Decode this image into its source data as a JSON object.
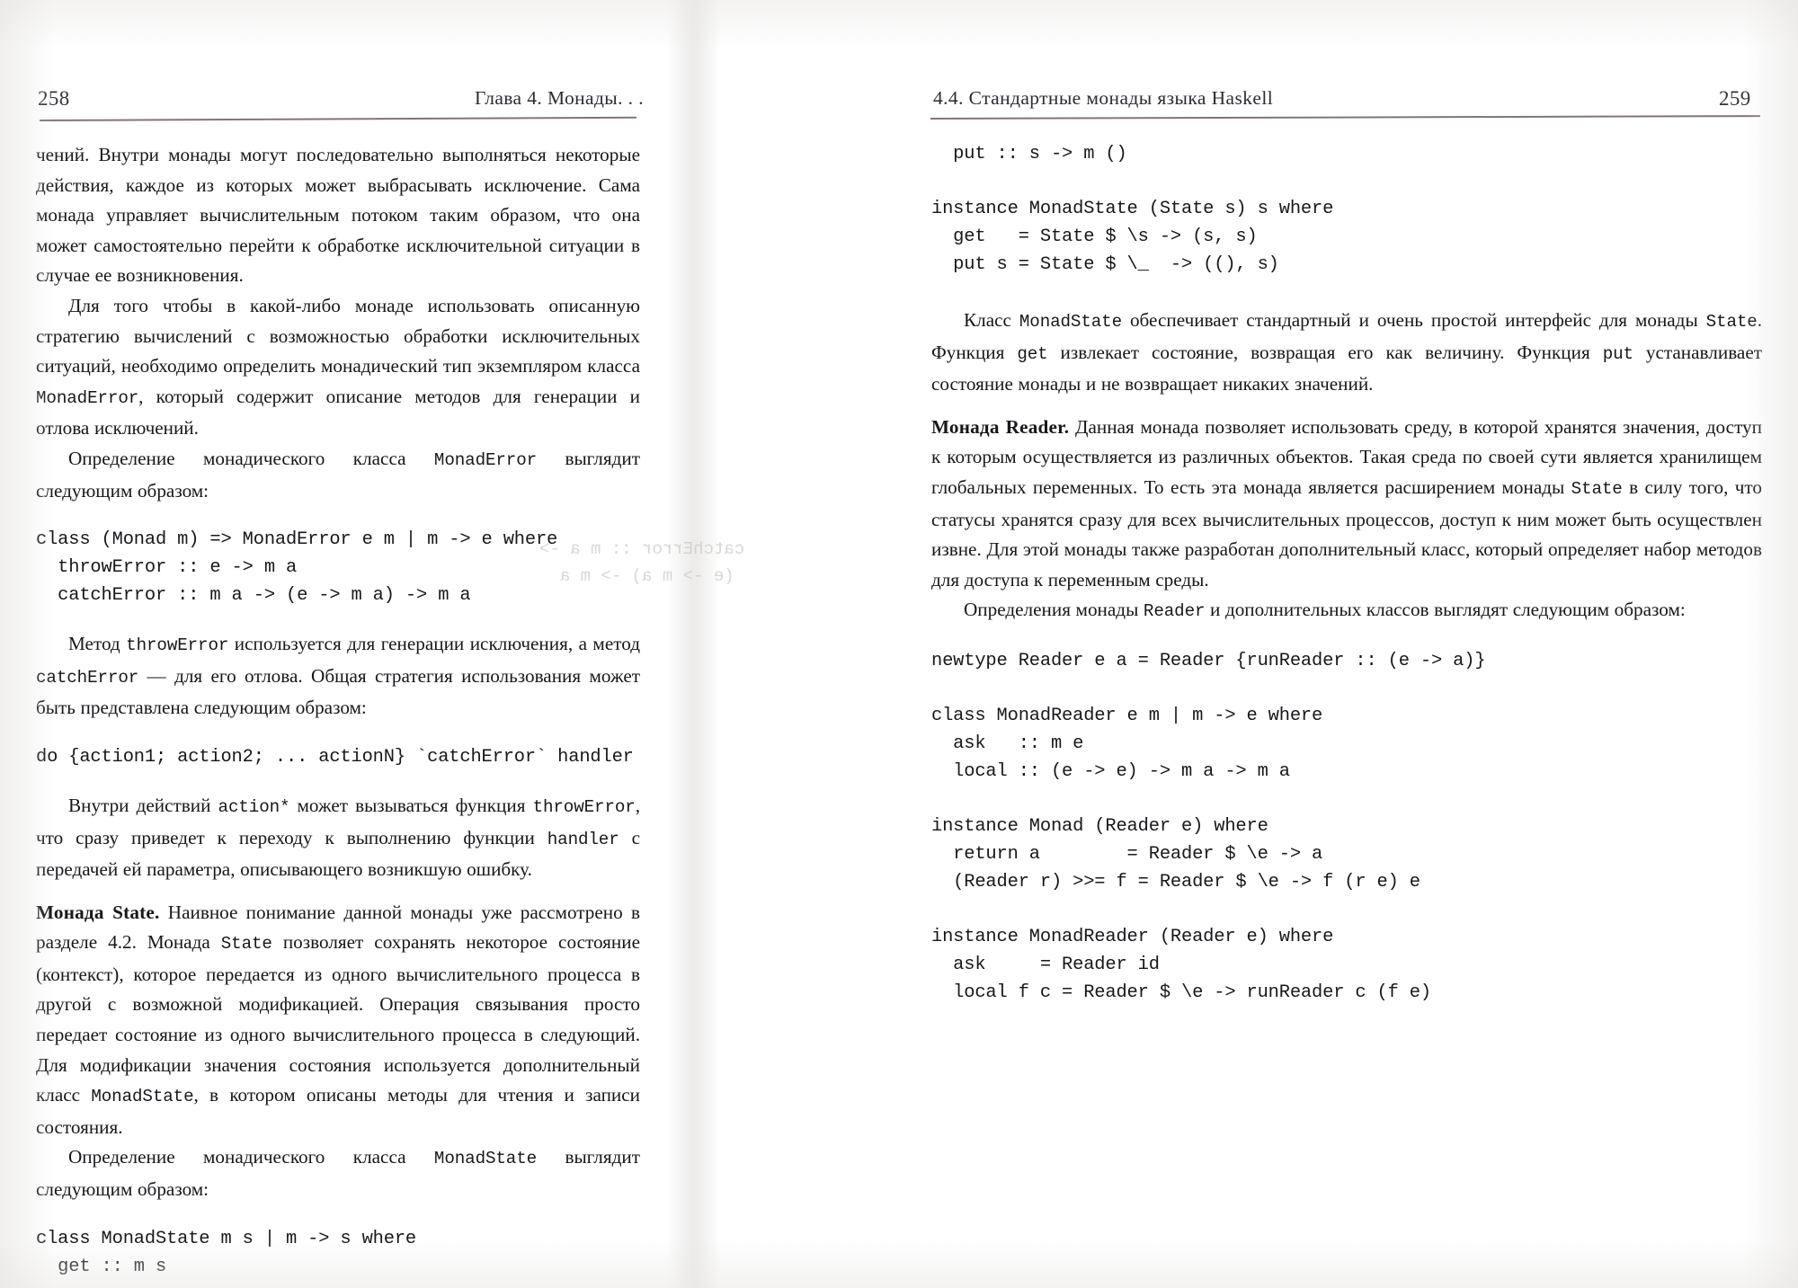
{
  "spread": {
    "left_page": {
      "folio": "258",
      "running_head": "Глава 4.  Монады. . ."
    },
    "right_page": {
      "folio": "259",
      "running_head": "4.4.  Стандартные монады языка Haskell"
    }
  },
  "left_column": {
    "p1": "чений. Внутри монады могут последовательно выполняться некоторые действия, каждое из которых может выбрасывать исключение. Сама монада управляет вычислительным потоком таким образом, что она может самостоятельно перейти к обработке исключительной ситуации в случае ее возникновения.",
    "p2_a": "Для того чтобы в какой-либо монаде использовать описанную стратегию вычислений с возможностью обработки исключительных ситуаций, необходимо определить монадический тип экземпляром класса ",
    "p2_code": "MonadError",
    "p2_b": ", который содержит описание методов для генерации и отлова исключений.",
    "p3_a": "Определение монадического класса ",
    "p3_code": "MonadError",
    "p3_b": " выглядит следующим образом:",
    "code1": "class (Monad m) => MonadError e m | m -> e where\n  throwError :: e -> m a\n  catchError :: m a -> (e -> m a) -> m a",
    "p4_a": "Метод ",
    "p4_code1": "throwError",
    "p4_b": " используется для генерации исключения, а метод ",
    "p4_code2": "catchError",
    "p4_c": " — для его отлова. Общая стратегия использования может быть представлена следующим образом:",
    "code2": "do {action1; action2; ... actionN} `catchError` handler",
    "p5_a": "Внутри действий ",
    "p5_code1": "action*",
    "p5_b": " может вызываться функция ",
    "p5_code2": "throwError",
    "p5_c": ", что сразу приведет к переходу к выполнению функции ",
    "p5_code3": "handler",
    "p5_d": " с передачей ей параметра, описывающего возникшую ошибку.",
    "p6_lead": "Монада State.",
    "p6_a": " Наивное понимание данной монады уже рассмотрено в разделе 4.2. Монада ",
    "p6_code1": "State",
    "p6_b": " позволяет сохранять некоторое состояние (контекст), которое передается из одного вычислительного процесса в другой с возможной модификацией. Операция связывания просто передает состояние из одного вычислительного процесса в следующий. Для модификации значения состояния используется дополнительный класс ",
    "p6_code2": "MonadState",
    "p6_c": ", в котором описаны методы для чтения и записи состояния.",
    "p7_a": "Определение монадического класса ",
    "p7_code": "MonadState",
    "p7_b": " выглядит следующим образом:",
    "code3": "class MonadState m s | m -> s where\n  get :: m s"
  },
  "right_column": {
    "code4": "  put :: s -> m ()",
    "code5": "instance MonadState (State s) s where\n  get   = State $ \\s -> (s, s)\n  put s = State $ \\_  -> ((), s)",
    "p1_a": "Класс ",
    "p1_code1": "MonadState",
    "p1_b": " обеспечивает стандартный и очень простой интерфейс для монады ",
    "p1_code2": "State",
    "p1_c": ". Функция ",
    "p1_code3": "get",
    "p1_d": " извлекает состояние, возвращая его как величину. Функция ",
    "p1_code4": "put",
    "p1_e": " устанавливает состояние монады и не возвращает никаких значений.",
    "p2_lead": "Монада Reader.",
    "p2_a": " Данная монада позволяет использовать среду, в которой хранятся значения, доступ к которым осуществляется из различных объектов. Такая среда по своей сути является хранилищем глобальных переменных. То есть эта монада является расширением монады ",
    "p2_code1": "State",
    "p2_b": " в силу того, что статусы хранятся сразу для всех вычислительных процессов, доступ к ним может быть осуществлен извне. Для этой монады также разработан дополнительный класс, который определяет набор методов для доступа к переменным среды.",
    "p3_a": "Определения монады ",
    "p3_code": "Reader",
    "p3_b": " и дополнительных классов выглядят следующим образом:",
    "code6": "newtype Reader e a = Reader {runReader :: (e -> a)}",
    "code7": "class MonadReader e m | m -> e where\n  ask   :: m e\n  local :: (e -> e) -> m a -> m a",
    "code8": "instance Monad (Reader e) where\n  return a        = Reader $ \\e -> a\n  (Reader r) >>= f = Reader $ \\e -> f (r e) e",
    "code9": "instance MonadReader (Reader e) where\n  ask     = Reader id\n  local f c = Reader $ \\e -> runReader c (f e)"
  },
  "colors": {
    "rule": "#6d5a63",
    "ink": "#17171c",
    "paper": "#ffffff"
  }
}
